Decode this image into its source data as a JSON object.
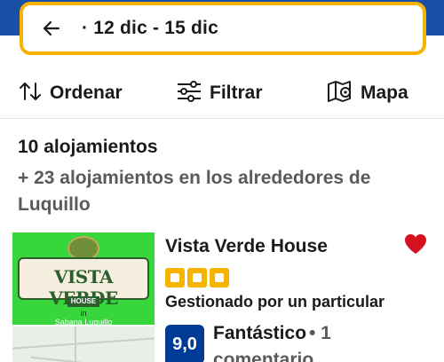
{
  "search": {
    "dates": "· 12 dic - 15 dic"
  },
  "toolbar": {
    "sort_label": "Ordenar",
    "filter_label": "Filtrar",
    "map_label": "Mapa"
  },
  "results": {
    "count_text": "10 alojamientos",
    "nearby_text": "+ 23 alojamientos en los alrededores de Luquillo"
  },
  "property": {
    "name": "Vista Verde House",
    "star_count": 3,
    "managed_by": "Gestionado por un particular",
    "score": "9,0",
    "rating_word": "Fantástico",
    "rating_count_line1": "• 1",
    "rating_count_line2": "comentario",
    "favorite": true,
    "image": {
      "title": "VISTA VERDE",
      "tag": "HOUSE",
      "in_text": "in",
      "location_text": "Sabana,Luquillo"
    }
  },
  "colors": {
    "brand_blue": "#1a4fa8",
    "highlight_yellow": "#f4b400",
    "score_blue": "#003b95",
    "heart_red": "#d4111e"
  }
}
